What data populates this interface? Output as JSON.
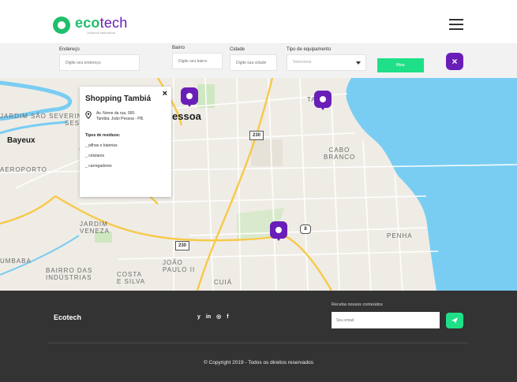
{
  "header": {
    "logo_name_a": "eco",
    "logo_name_b": "tech",
    "logo_tagline": "resíduos eletrônicos"
  },
  "filters": {
    "endereco": {
      "label": "Endereço",
      "placeholder": "Digite seu endereço"
    },
    "bairro": {
      "label": "Bairro",
      "placeholder": "Digite seu bairro"
    },
    "cidade": {
      "label": "Cidade",
      "placeholder": "Digite sua cidade"
    },
    "tipo": {
      "label": "Tipo de equipamento",
      "selected": "Selecionar"
    },
    "filter_button": "filtrar",
    "close_symbol": "×"
  },
  "map": {
    "labels": {
      "jardim_sao_severino": "JARDIM SÃO SEVERINO",
      "ses": "SES",
      "bayeux": "Bayeux",
      "aeroporto": "AEROPORTO",
      "pessoa": "essoa",
      "ta": "TA",
      "cabo_branco": "CABO BRANCO",
      "jardim_veneza": "JARDIM VENEZA",
      "penha": "PENHA",
      "umbaba": "UMBABA",
      "bairro_das_industrias": "BAIRRO DAS INDÚSTRIAS",
      "costa_e_silva": "COSTA E SILVA",
      "joao_paulo_ii": "JOÃO PAULO II",
      "cuia": "CUIÁ"
    },
    "shields": {
      "r230a": "230",
      "r230b": "230",
      "r8": "8"
    },
    "colors": {
      "water": "#79cdf2",
      "land": "#efece6",
      "major_road": "#f7c948",
      "road": "#ffffff",
      "park": "#cfe8c1",
      "pin": "#6a1eb8"
    }
  },
  "popup": {
    "title": "Shopping Tambiá",
    "address_line1": "Av. Nome da rua, 000.",
    "address_line2": "Tambiá, João Pessoa - PB.",
    "types_heading": "Tipos de resíduos:",
    "items": [
      "_ pilhas e baterias",
      "_ celulares",
      "_ carregadores"
    ],
    "close_symbol": "×"
  },
  "footer": {
    "brand": "Ecotech",
    "social": {
      "twitter": "y",
      "linkedin": "in",
      "instagram": "◎",
      "facebook": "f"
    },
    "newsletter_label": "Receba nossos conteúdos",
    "newsletter_placeholder": "Seu email",
    "copyright": "© Copyright 2019 - Todos os direitos reservados"
  },
  "colors": {
    "accent_green": "#1fe088",
    "brand_green": "#1fbf6b",
    "brand_purple": "#6a1eb8",
    "footer_bg": "#333333"
  }
}
